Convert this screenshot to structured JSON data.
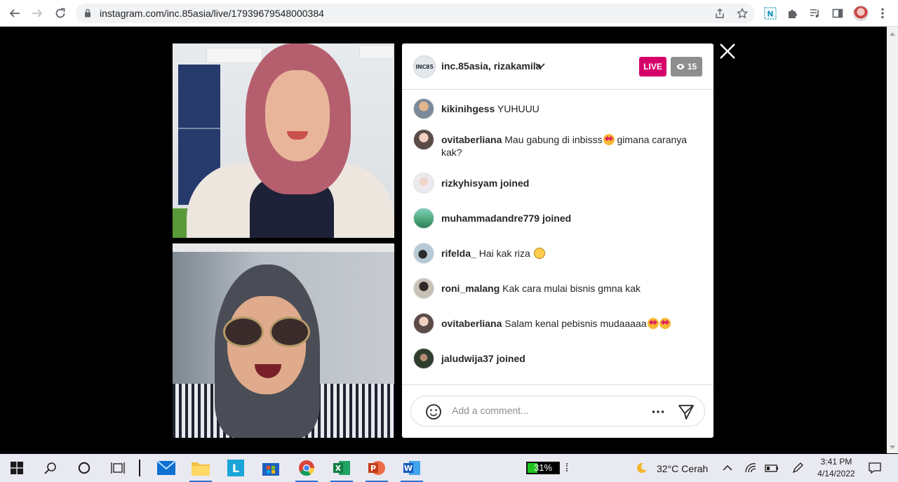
{
  "browser": {
    "url": "instagram.com/inc.85asia/live/17939679548000384"
  },
  "live": {
    "hosts": "inc.85asia, rizakamila",
    "host_avatar_text": "INC85",
    "live_label": "LIVE",
    "viewer_count": "15",
    "comments": [
      {
        "user": "kikinihgess",
        "text": " YUHUUU",
        "emoji": "",
        "avatar_color": "#7a8a99"
      },
      {
        "user": "ovitaberliana",
        "text": " Mau gabung di inbisss",
        "emoji": "star",
        "text2": " gimana caranya kak?",
        "avatar_color": "#5a4a48"
      },
      {
        "user": "rizkyhisyam",
        "text": " joined",
        "emoji": "",
        "avatar_color": "#b9b4c2"
      },
      {
        "user": "muhammadandre779",
        "text": " joined",
        "emoji": "",
        "avatar_color": "#5fb58f"
      },
      {
        "user": "rifelda_",
        "text": " Hai kak riza ",
        "emoji": "smile",
        "avatar_color": "#9fb7c4"
      },
      {
        "user": "roni_malang",
        "text": " Kak cara mulai bisnis gmna kak",
        "emoji": "",
        "avatar_color": "#c9c0b6"
      },
      {
        "user": "ovitaberliana",
        "text": " Salam kenal pebisnis mudaaaaa",
        "emoji": "star2",
        "avatar_color": "#5a4a48"
      },
      {
        "user": "jaludwija37",
        "text": " joined",
        "emoji": "",
        "avatar_color": "#2f3d2e"
      }
    ],
    "comment_placeholder": "Add a comment..."
  },
  "taskbar": {
    "battery_text": "31%",
    "battery_level": 0.31,
    "weather": "32°C  Cerah",
    "time": "3:41 PM",
    "date": "4/14/2022"
  },
  "colors": {
    "live_badge": "#d6006b",
    "viewer_badge": "#8e8e8e",
    "page_background": "#000000"
  }
}
